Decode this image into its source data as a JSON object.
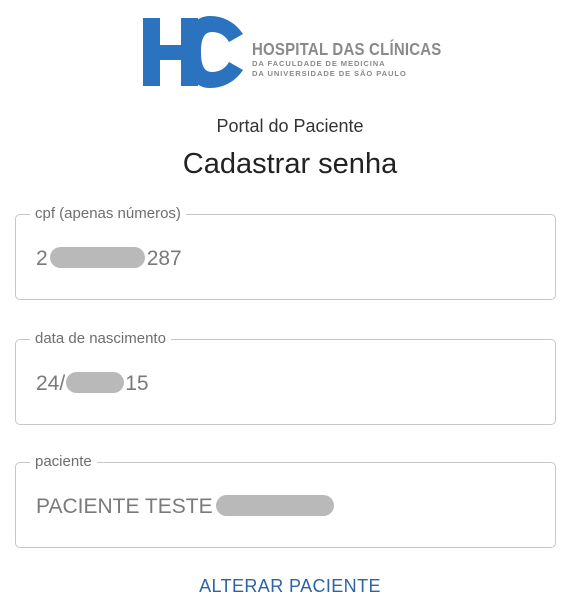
{
  "logo": {
    "mark": "HC",
    "line1": "HOSPITAL DAS CLÍNICAS",
    "line2": "DA FACULDADE DE MEDICINA",
    "line3": "DA UNIVERSIDADE DE SÃO PAULO",
    "colors": {
      "blue": "#2b73bf",
      "text": "#8a8a8a"
    }
  },
  "portal_label": "Portal do Paciente",
  "page_title": "Cadastrar senha",
  "form": {
    "cpf": {
      "label": "cpf (apenas números)",
      "value_prefix": "2",
      "value_suffix": "287"
    },
    "birth_date": {
      "label": "data de nascimento",
      "value_prefix": "24/",
      "value_suffix": "15"
    },
    "patient": {
      "label": "paciente",
      "value_prefix": "PACIENTE TESTE",
      "value_suffix": ""
    }
  },
  "change_patient_label": "ALTERAR PACIENTE",
  "colors": {
    "link": "#2c64a6",
    "mask": "#b9b9b9",
    "border": "#c7c7c7"
  }
}
